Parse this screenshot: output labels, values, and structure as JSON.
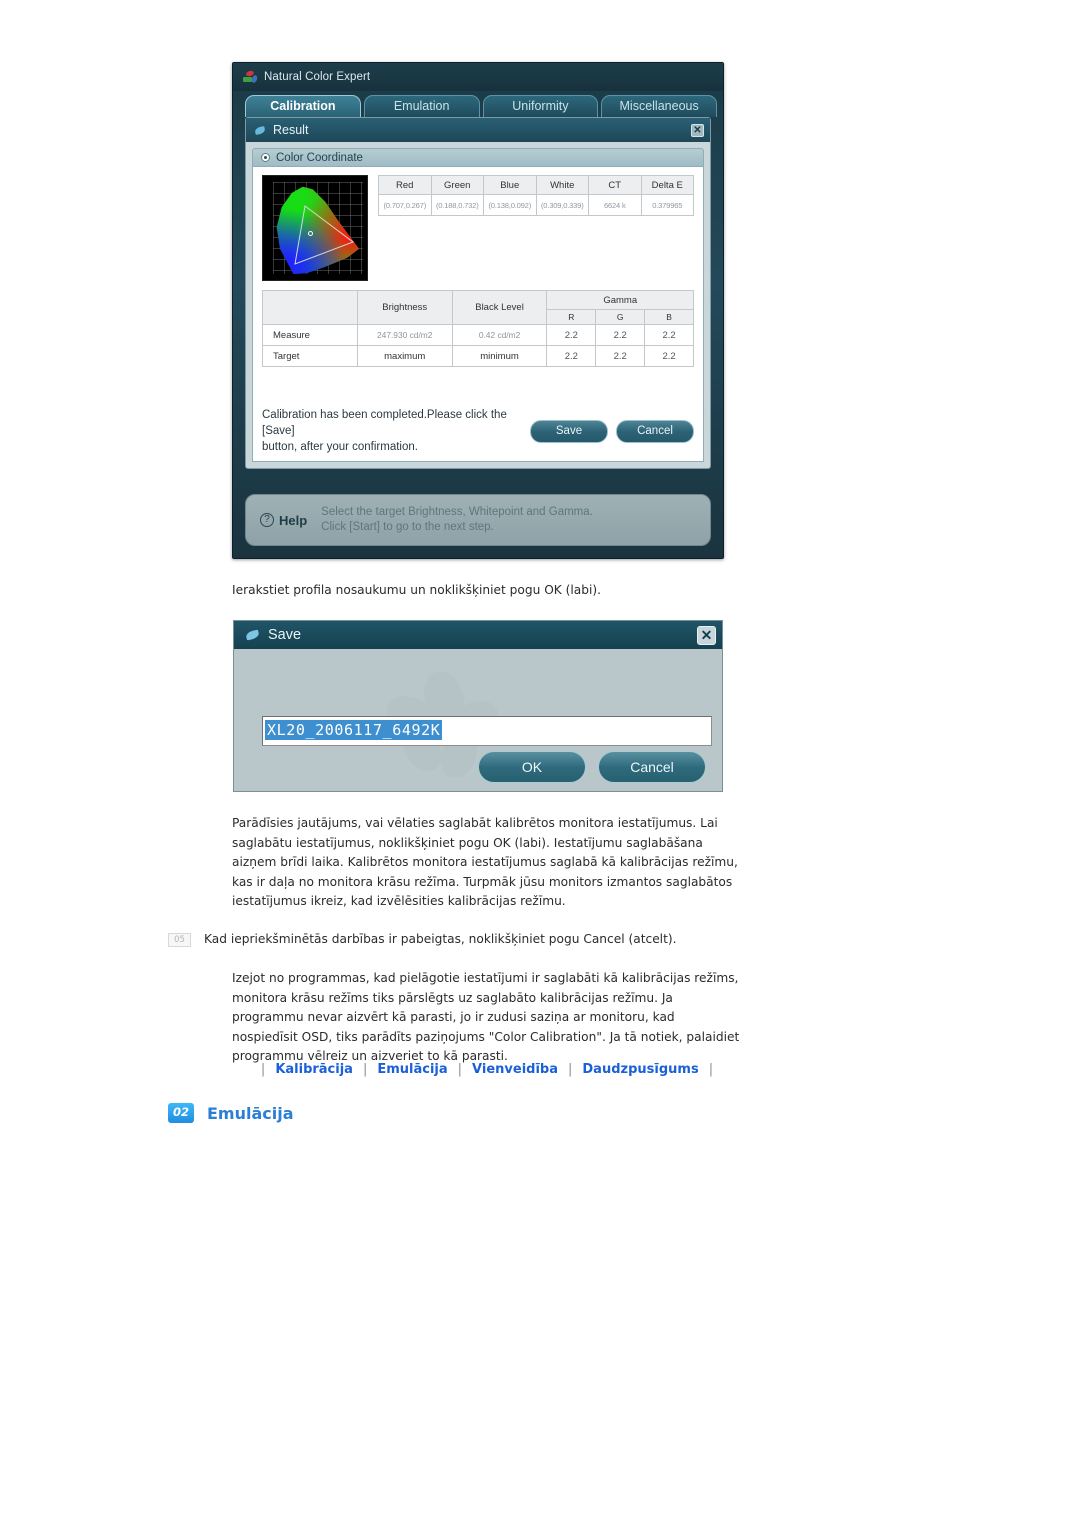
{
  "app": {
    "title": "Natural Color Expert",
    "tabs": [
      {
        "label": "Calibration",
        "active": true
      },
      {
        "label": "Emulation",
        "active": false
      },
      {
        "label": "Uniformity",
        "active": false
      },
      {
        "label": "Miscellaneous",
        "active": false
      }
    ],
    "result_panel": {
      "title": "Result",
      "close_label": "✕",
      "section_label": "Color Coordinate",
      "coord_table": {
        "headers": [
          "Red",
          "Green",
          "Blue",
          "White",
          "CT",
          "Delta E"
        ],
        "values": [
          "(0.707,0.267)",
          "(0.188,0.732)",
          "(0.138,0.092)",
          "(0.309,0.339)",
          "6624 k",
          "0.379965"
        ]
      },
      "gamma_table": {
        "col_blank": "",
        "col_brightness": "Brightness",
        "col_black_level": "Black Level",
        "col_gamma": "Gamma",
        "gamma_sub": [
          "R",
          "G",
          "B"
        ],
        "rows": [
          {
            "label": "Measure",
            "brightness": "247.930 cd/m2",
            "black_level": "0.42 cd/m2",
            "gamma": [
              "2.2",
              "2.2",
              "2.2"
            ]
          },
          {
            "label": "Target",
            "brightness": "maximum",
            "black_level": "minimum",
            "gamma": [
              "2.2",
              "2.2",
              "2.2"
            ]
          }
        ]
      },
      "message_line1": "Calibration has been completed.Please click the [Save]",
      "message_line2": "button, after your confirmation.",
      "save_button": "Save",
      "cancel_button": "Cancel"
    },
    "help": {
      "icon_char": "?",
      "label": "Help",
      "line1": "Select the target Brightness, Whitepoint and Gamma.",
      "line2": "Click [Start] to go to the next step."
    }
  },
  "save_dialog": {
    "title": "Save",
    "close_label": "✕",
    "input_value": "XL20_2006117_6492K",
    "ok_button": "OK",
    "cancel_button": "Cancel"
  },
  "document": {
    "intro": "Ierakstiet profila nosaukumu un noklikšķiniet pogu OK (labi).",
    "paragraph_save": "Parādīsies jautājums, vai vēlaties saglabāt kalibrētos monitora iestatījumus. Lai saglabātu iestatījumus, noklikšķiniet pogu OK (labi). Iestatījumu saglabāšana aizņem brīdi laika. Kalibrētos monitora iestatījumus saglabā kā kalibrācijas režīmu, kas ir daļa no monitora krāsu režīma. Turpmāk jūsu monitors izmantos saglabātos iestatījumus ikreiz, kad izvēlēsities kalibrācijas režīmu.",
    "step_number": "05",
    "step_text": "Kad iepriekšminētās darbības ir pabeigtas, noklikšķiniet pogu Cancel (atcelt).",
    "paragraph_exit": "Izejot no programmas, kad pielāgotie iestatījumi ir saglabāti kā kalibrācijas režīms, monitora krāsu režīms tiks pārslēgts uz saglabāto kalibrācijas režīmu. Ja programmu nevar aizvērt kā parasti, jo ir zudusi saziņa ar monitoru, kad nospiedīsit OSD, tiks parādīts paziņojums \"Color Calibration\". Ja tā notiek, palaidiet programmu vēlreiz un aizveriet to kā parasti.",
    "nav_links": [
      "Kalibrācija",
      "Emulācija",
      "Vienveidība",
      "Daudzpusīgums"
    ],
    "nav_separator": "|",
    "heading_badge": "02",
    "heading_text": "Emulācija"
  },
  "colors": {
    "link": "#1b5fd9",
    "heading": "#2b7fd4",
    "badge": "#1f8ee0",
    "window_bg": "#23495a",
    "panel_bg": "#c9d6da"
  }
}
